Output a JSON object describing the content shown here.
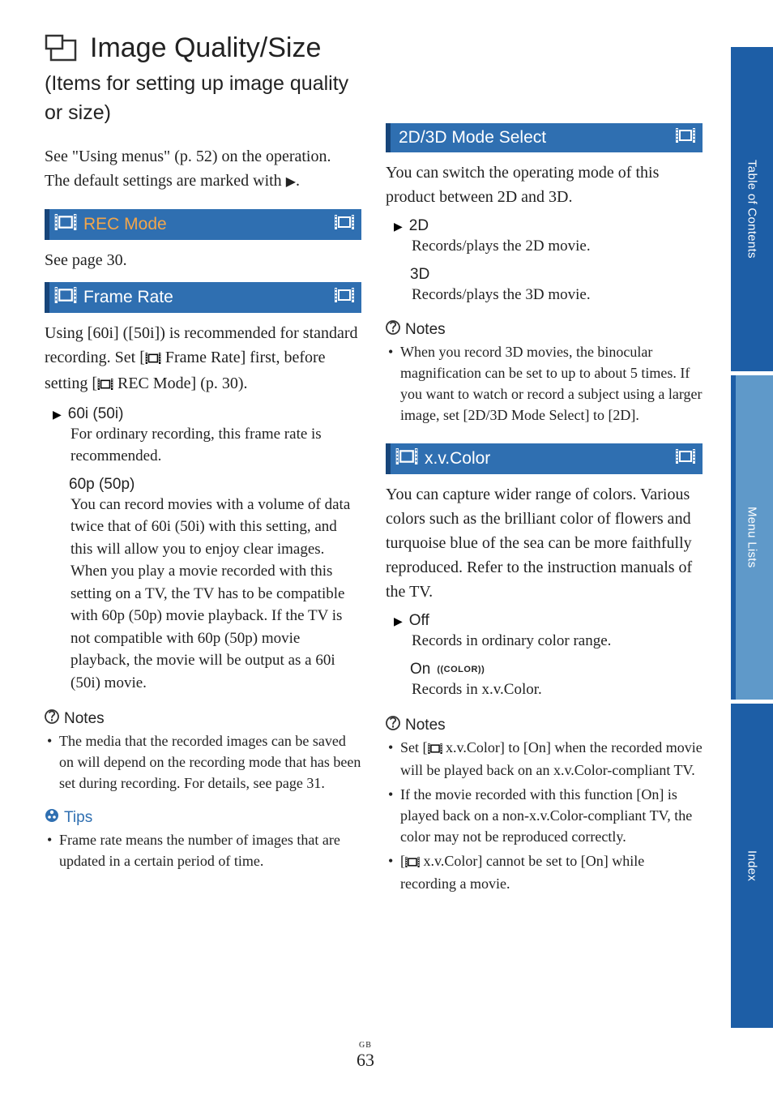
{
  "title": "Image Quality/Size",
  "subtitle": "(Items for setting up image quality or size)",
  "intro_line1": "See \"Using menus\" (p. 52) on the operation.",
  "intro_line2_pre": "The default settings are marked with ",
  "intro_line2_post": ".",
  "sections": {
    "rec_mode": {
      "label": "REC Mode",
      "body": "See page 30."
    },
    "frame_rate": {
      "label": "Frame Rate",
      "body_pre": "Using [60i] ([50i]) is recommended for standard recording. Set [",
      "body_mid": " Frame Rate] first, before setting [",
      "body_post": " REC Mode] (p. 30).",
      "options": [
        {
          "head": "60i (50i)",
          "default": true,
          "desc": "For ordinary recording, this frame rate is recommended."
        },
        {
          "head": "60p (50p)",
          "default": false,
          "desc": "You can record movies with a volume of data twice that of 60i (50i) with this setting, and this will allow you to enjoy clear images. When you play a movie recorded with this setting on a TV, the TV has to be compatible with 60p (50p) movie playback. If the TV is not compatible with 60p (50p) movie playback, the movie will be output as a 60i (50i) movie."
        }
      ],
      "notes": [
        "The media that the recorded images can be saved on will depend on the recording mode that has been set during recording. For details, see page 31."
      ],
      "tips": [
        "Frame rate means the number of images that are updated in a certain period of time."
      ]
    },
    "mode_select": {
      "label": "2D/3D Mode Select",
      "body": "You can switch the operating mode of this product between 2D and 3D.",
      "options": [
        {
          "head": "2D",
          "default": true,
          "desc": "Records/plays the 2D movie."
        },
        {
          "head": "3D",
          "default": false,
          "desc": "Records/plays the 3D movie."
        }
      ],
      "notes": [
        "When you record 3D movies, the binocular magnification can be set to up to about 5 times. If you want to watch or record a subject using a larger image, set [2D/3D Mode Select] to [2D]."
      ]
    },
    "xvcolor": {
      "label": "x.v.Color",
      "body": "You can capture wider range of colors. Various colors such as the brilliant color of flowers and turquoise blue of the sea can be more faithfully reproduced. Refer to the instruction manuals of the TV.",
      "options": [
        {
          "head": "Off",
          "default": true,
          "desc": "Records in ordinary color range."
        },
        {
          "head": "On",
          "mark": "((COLOR))",
          "default": false,
          "desc": "Records in x.v.Color."
        }
      ],
      "notes_pre1": "Set [",
      "notes_post1": " x.v.Color] to [On] when the recorded movie will be played back on an x.v.Color-compliant TV.",
      "note2": "If the movie recorded with this function [On] is played back on a non-x.v.Color-compliant TV, the color may not be reproduced correctly.",
      "notes_pre3": "[",
      "notes_post3": " x.v.Color] cannot be set to [On] while recording a movie."
    }
  },
  "labels": {
    "notes": "Notes",
    "tips": "Tips"
  },
  "side": {
    "toc": "Table of Contents",
    "menu": "Menu Lists",
    "index": "Index"
  },
  "footer": {
    "gb": "GB",
    "page": "63"
  }
}
